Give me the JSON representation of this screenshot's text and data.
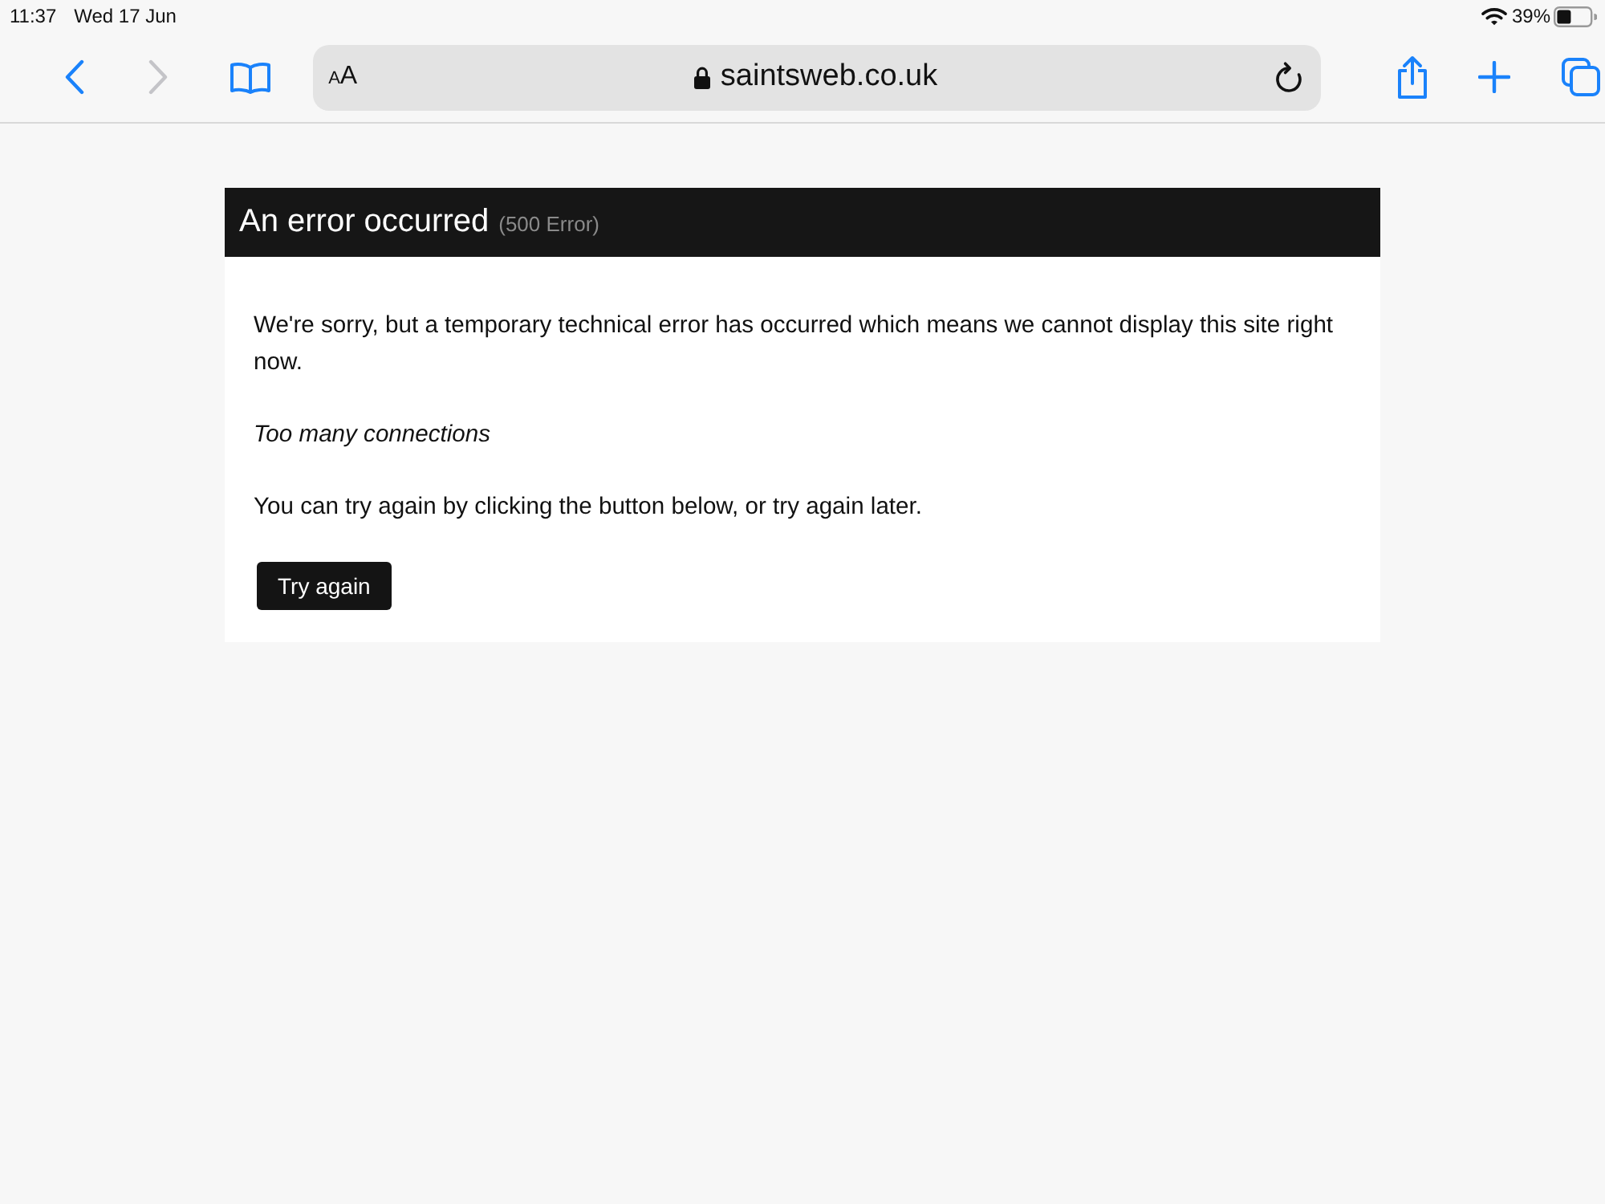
{
  "status_bar": {
    "time": "11:37",
    "date": "Wed 17 Jun",
    "battery_percent": "39%"
  },
  "toolbar": {
    "nav_buttons": [
      {
        "kind": "back",
        "disabled": false
      },
      {
        "kind": "forward",
        "disabled": true
      },
      {
        "kind": "bookmarks",
        "disabled": false
      }
    ],
    "address_bar": {
      "text_size_label": "AA",
      "url": "saintsweb.co.uk",
      "secure": true
    },
    "action_buttons": [
      {
        "kind": "share"
      },
      {
        "kind": "new_tab"
      },
      {
        "kind": "tabs"
      }
    ]
  },
  "error_card": {
    "title": "An error occurred",
    "code": "(500 Error)",
    "paragraphs": [
      {
        "kind": "message",
        "text": "We're sorry, but a temporary technical error has occurred which means we cannot display this site right now."
      },
      {
        "kind": "detail",
        "text": "Too many connections"
      },
      {
        "kind": "message",
        "text": "You can try again by clicking the button below, or try again later."
      }
    ],
    "button": "Try again"
  }
}
